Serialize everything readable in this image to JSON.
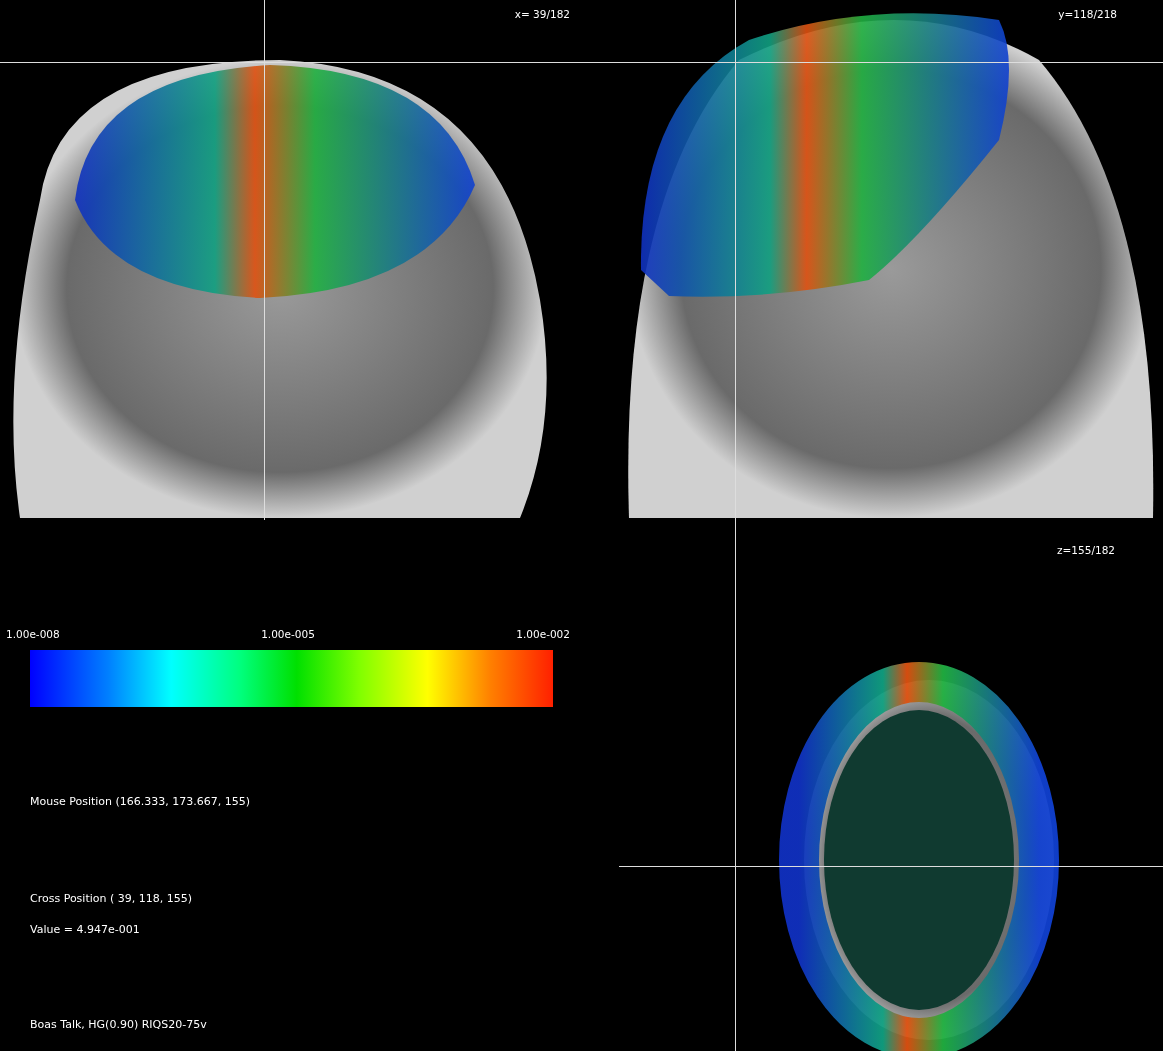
{
  "views": [
    {
      "kind": "sagittal",
      "label": "x= 39/182"
    },
    {
      "kind": "coronal",
      "label": "y=118/218"
    },
    {
      "kind": "axial",
      "label": "z=155/182"
    }
  ],
  "colorbar": {
    "ticks": [
      "1.00e-008",
      "1.00e-005",
      "1.00e-002"
    ]
  },
  "info": {
    "mouse_position": "Mouse Position (166.333, 173.667, 155)",
    "cross_position": "Cross Position ( 39, 118, 155)",
    "value": "Value = 4.947e-001",
    "caption": "Boas Talk, HG(0.90) RIQS20-75v"
  }
}
